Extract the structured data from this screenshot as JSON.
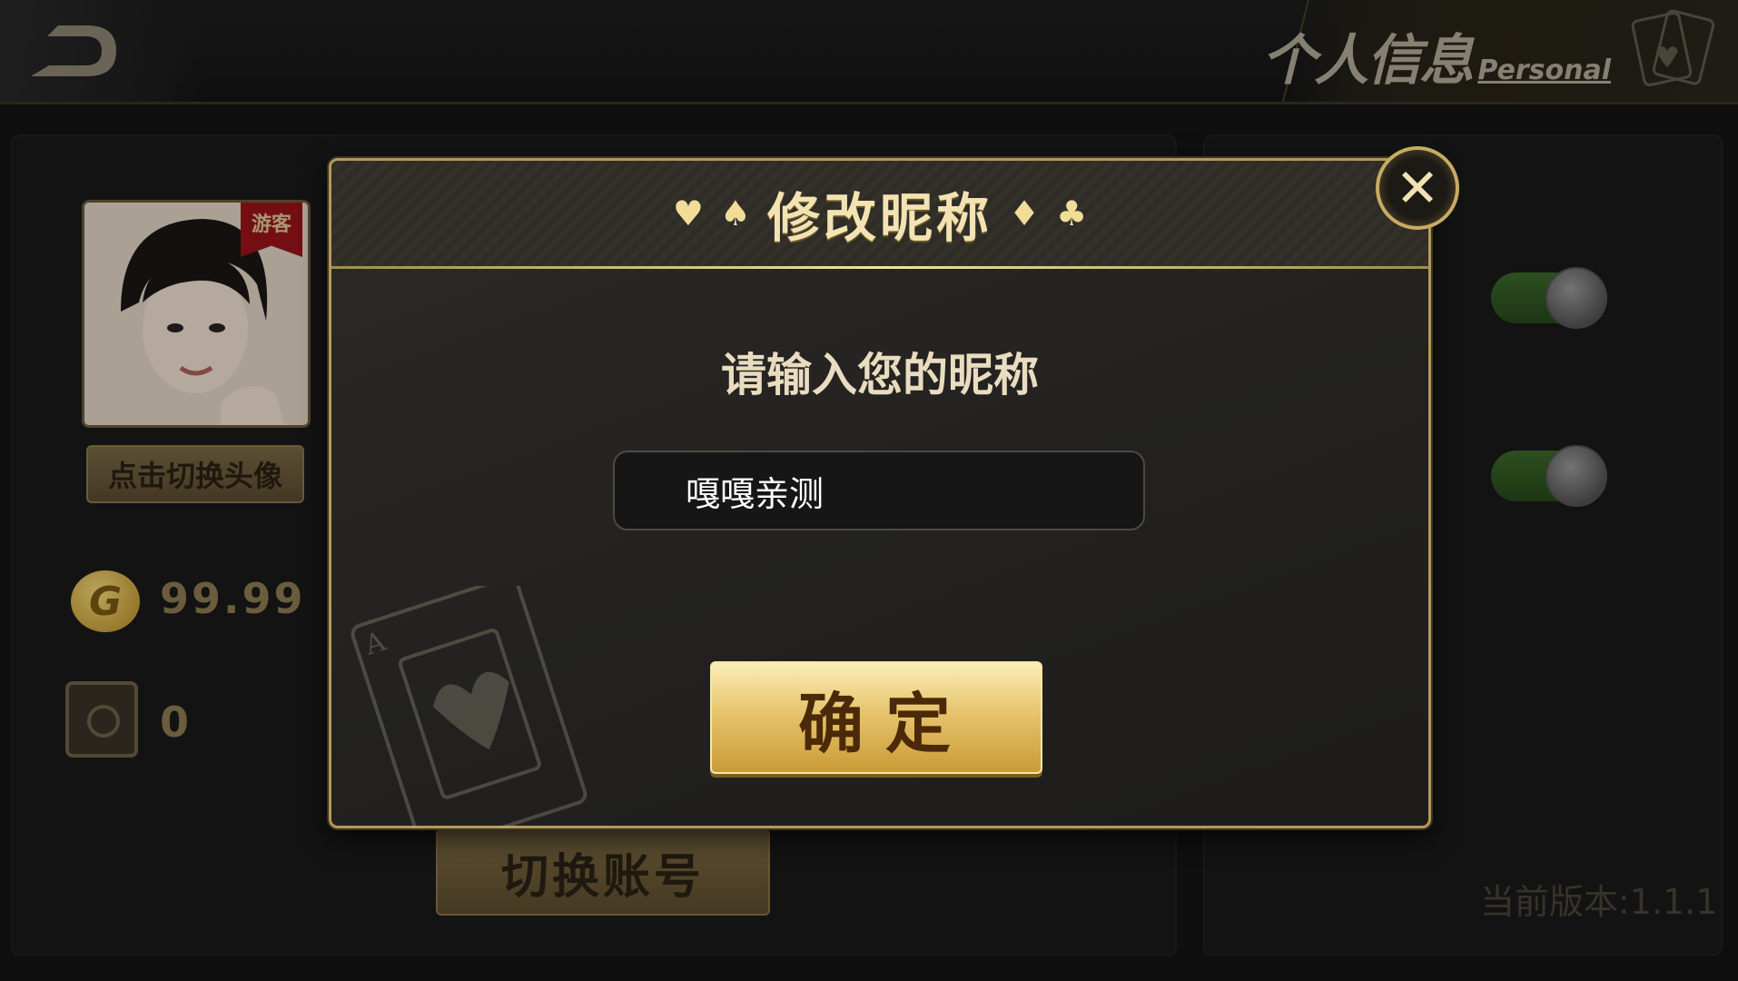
{
  "header": {
    "title_cn": "个人信息",
    "title_en": "Personal"
  },
  "profile": {
    "guest_tag": "游客",
    "change_avatar_label": "点击切换头像",
    "coin_symbol": "G",
    "coin_value": "99.99",
    "safe_value": "0",
    "switch_account_label": "切换账号"
  },
  "settings": {
    "toggle_1_on": true,
    "toggle_2_on": true,
    "version_text": "当前版本:1.1.1"
  },
  "dialog": {
    "title": "修改昵称",
    "suits": [
      "♥",
      "♠",
      "♦",
      "♣"
    ],
    "prompt": "请输入您的昵称",
    "input_value": "嘎嘎亲测",
    "close_symbol": "✕",
    "confirm_label": "确定"
  },
  "colors": {
    "accent_gold": "#c8ab62",
    "dialog_bg": "#232220",
    "toggle_on": "#3c6a2a"
  }
}
